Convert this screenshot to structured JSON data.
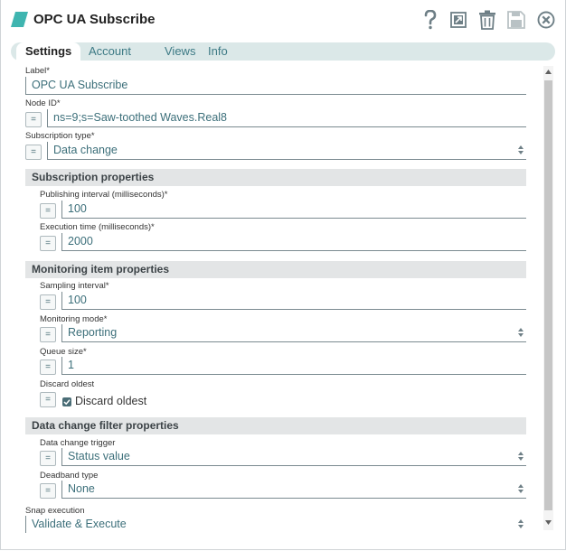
{
  "header": {
    "title": "OPC UA Subscribe",
    "brand_color": "#3fb5b0",
    "icons": [
      "help-icon",
      "export-icon",
      "delete-icon",
      "save-icon",
      "close-icon"
    ]
  },
  "tabs": [
    {
      "label": "Settings",
      "active": true
    },
    {
      "label": "Account",
      "active": false
    },
    {
      "label": "Views",
      "active": false
    },
    {
      "label": "Info",
      "active": false
    }
  ],
  "fields": {
    "label": {
      "label": "Label*",
      "value": "OPC UA Subscribe"
    },
    "node_id": {
      "label": "Node ID*",
      "value": "ns=9;s=Saw-toothed Waves.Real8"
    },
    "subscription_type": {
      "label": "Subscription type*",
      "value": "Data change"
    },
    "publishing_interval": {
      "label": "Publishing interval (milliseconds)*",
      "value": "100"
    },
    "execution_time": {
      "label": "Execution time (milliseconds)*",
      "value": "2000"
    },
    "sampling_interval": {
      "label": "Sampling interval*",
      "value": "100"
    },
    "monitoring_mode": {
      "label": "Monitoring mode*",
      "value": "Reporting"
    },
    "queue_size": {
      "label": "Queue size*",
      "value": "1"
    },
    "discard_oldest": {
      "label": "Discard oldest",
      "checkbox_label": "Discard oldest",
      "checked": true
    },
    "data_change_trigger": {
      "label": "Data change trigger",
      "value": "Status value"
    },
    "deadband_type": {
      "label": "Deadband type",
      "value": "None"
    },
    "snap_execution": {
      "label": "Snap execution",
      "value": "Validate & Execute"
    }
  },
  "sections": {
    "subscription": "Subscription properties",
    "monitoring": "Monitoring item properties",
    "filter": "Data change filter properties"
  },
  "expr_button": "="
}
